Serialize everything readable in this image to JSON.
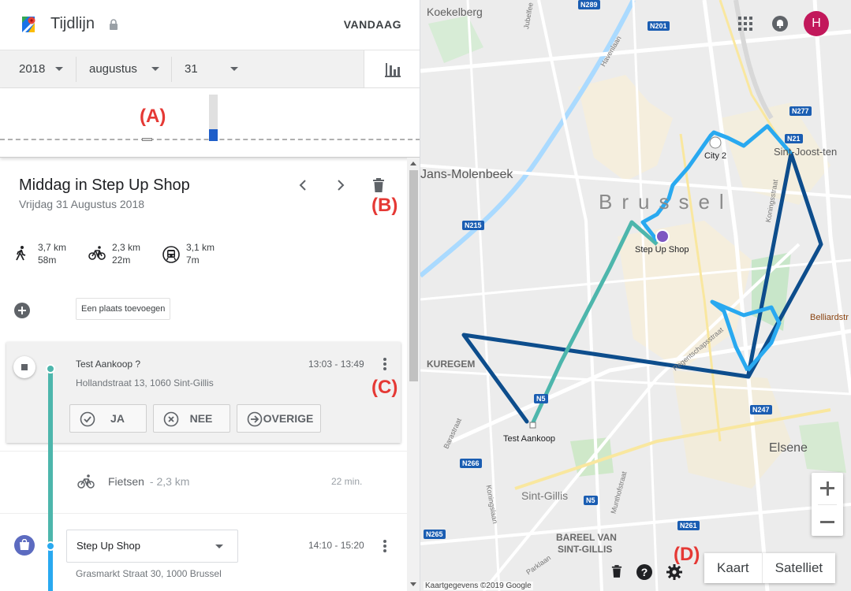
{
  "header": {
    "title": "Tijdlijn",
    "today_button": "VANDAAG"
  },
  "date_selector": {
    "year": "2018",
    "month": "augustus",
    "day": "31"
  },
  "annotations": {
    "a": "(A)",
    "b": "(B)",
    "c": "(C)",
    "d": "(D)"
  },
  "place_card": {
    "title": "Middag in Step Up Shop",
    "date": "Vrijdag 31 Augustus 2018"
  },
  "stats": [
    {
      "mode": "walking",
      "distance": "3,7 km",
      "duration": "58m"
    },
    {
      "mode": "cycling",
      "distance": "2,3 km",
      "duration": "22m"
    },
    {
      "mode": "transit",
      "distance": "3,1 km",
      "duration": "7m"
    }
  ],
  "add_place": "Een plaats toevoegen",
  "stop1": {
    "name": "Test Aankoop ?",
    "time": "13:03 - 13:49",
    "address": "Hollandstraat 13, 1060 Sint-Gillis",
    "buttons": {
      "yes": "JA",
      "no": "NEE",
      "other": "OVERIGE"
    }
  },
  "segment": {
    "mode": "Fietsen",
    "distance": " - 2,3 km",
    "duration": "22 min."
  },
  "stop2": {
    "name": "Step Up Shop",
    "time": "14:10 - 15:20",
    "address": "Grasmarkt Straat 30, 1000 Brussel"
  },
  "map": {
    "labels": {
      "koekelberg": "Koekelberg",
      "molenbeek": "Jans-Molenbeek",
      "brussel": "Brussel",
      "kuregem": "KUREGEM",
      "elsene": "Elsene",
      "sint_gillis": "Sint-Gillis",
      "bareel1": "BAREEL VAN",
      "bareel2": "SINT-GILLIS",
      "sint_joost": "Sint-Joost-ten",
      "belliard": "Belliardstr",
      "city2": "City 2",
      "step_up": "Step Up Shop",
      "test_aankoop": "Test Aankoop",
      "havenlaan": "Havenlaan",
      "koningsstraat": "Koningsstraat",
      "regentschap": "Regentschapsstraat",
      "barastraat": "Barastraat",
      "koningslaan": "Koningslaan",
      "munthof": "Munthofstraat",
      "parklaan": "Parklaan",
      "jubelfeest": "Jubelfee"
    },
    "roads": [
      "N289",
      "N201",
      "N277",
      "N21",
      "N215",
      "N5",
      "N247",
      "N266",
      "N261",
      "N265"
    ],
    "map_types": {
      "map": "Kaart",
      "satellite": "Satelliet"
    },
    "attribution": "Kaartgegevens ©2019 Google",
    "avatar_letter": "H"
  },
  "colors": {
    "cycling_route": "#4db6ac",
    "walking_route": "#29a9f0",
    "transit_route": "#0d4d8c",
    "avatar": "#c2185b",
    "annotation": "#e53935"
  }
}
